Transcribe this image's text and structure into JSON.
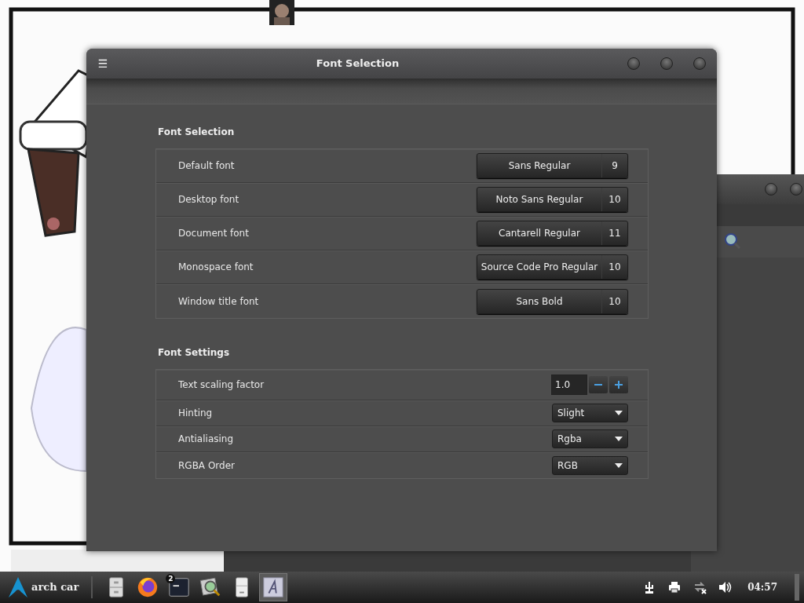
{
  "window": {
    "title": "Font Selection",
    "menu_glyph": "☰"
  },
  "font_selection": {
    "heading": "Font Selection",
    "rows": [
      {
        "label": "Default font",
        "font": "Sans Regular",
        "size": "9"
      },
      {
        "label": "Desktop font",
        "font": "Noto Sans Regular",
        "size": "10"
      },
      {
        "label": "Document font",
        "font": "Cantarell Regular",
        "size": "11"
      },
      {
        "label": "Monospace font",
        "font": "Source Code Pro Regular",
        "size": "10"
      },
      {
        "label": "Window title font",
        "font": "Sans Bold",
        "size": "10"
      }
    ]
  },
  "font_settings": {
    "heading": "Font Settings",
    "rows": [
      {
        "kind": "spin",
        "label": "Text scaling factor",
        "value": "1.0"
      },
      {
        "kind": "dropdown",
        "label": "Hinting",
        "value": "Slight"
      },
      {
        "kind": "dropdown",
        "label": "Antialiasing",
        "value": "Rgba"
      },
      {
        "kind": "dropdown",
        "label": "RGBA Order",
        "value": "RGB"
      }
    ]
  },
  "taskbar": {
    "start_label": "arch car",
    "apps": [
      {
        "kind": "cabinet",
        "selected": false
      },
      {
        "kind": "browser",
        "selected": false
      },
      {
        "kind": "terminal",
        "selected": false,
        "badge": "2"
      },
      {
        "kind": "viewer",
        "selected": false
      },
      {
        "kind": "drawer",
        "selected": false
      },
      {
        "kind": "font",
        "selected": true
      }
    ],
    "tray": [
      {
        "kind": "usb"
      },
      {
        "kind": "printer"
      },
      {
        "kind": "network"
      },
      {
        "kind": "volume"
      }
    ],
    "clock": "04:57"
  }
}
